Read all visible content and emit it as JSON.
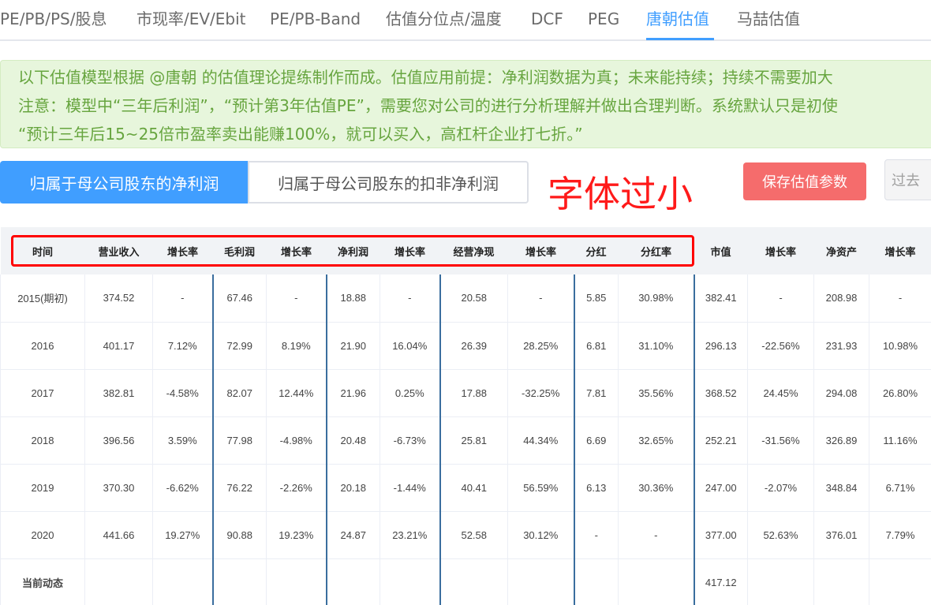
{
  "tabs": [
    {
      "label": "PE/PB/PS/股息",
      "active": false
    },
    {
      "label": "市现率/EV/Ebit",
      "active": false
    },
    {
      "label": "PE/PB-Band",
      "active": false
    },
    {
      "label": "估值分位点/温度",
      "active": false
    },
    {
      "label": "DCF",
      "active": false
    },
    {
      "label": "PEG",
      "active": false
    },
    {
      "label": "唐朝估值",
      "active": true
    },
    {
      "label": "马喆估值",
      "active": false
    }
  ],
  "notice": {
    "line1": "以下估值模型根据 @唐朝 的估值理论提练制作而成。估值应用前提：净利润数据为真；未来能持续；持续不需要加大",
    "line2": "注意：模型中“三年后利润”，“预计第3年估值PE”，需要您对公司的进行分析理解并做出合理判断。系统默认只是初使",
    "line3": "“预计三年后15~25倍市盈率卖出能赚100%，就可以买入，高杠杆企业打七折。”"
  },
  "switch": {
    "primary_label": "归属于母公司股东的净利润",
    "secondary_label": "归属于母公司股东的扣非净利润"
  },
  "annotation_text": "字体过小",
  "buttons": {
    "save_label": "保存估值参数",
    "past_label": "过去"
  },
  "table": {
    "headers": [
      "时间",
      "营业收入",
      "增长率",
      "毛利润",
      "增长率",
      "净利润",
      "增长率",
      "经营净现",
      "增长率",
      "分红",
      "分红率",
      "市值",
      "增长率",
      "净资产",
      "增长率"
    ],
    "rows": [
      [
        "2015(期初)",
        "374.52",
        "-",
        "67.46",
        "-",
        "18.88",
        "-",
        "20.58",
        "-",
        "5.85",
        "30.98%",
        "382.41",
        "-",
        "208.98",
        "-"
      ],
      [
        "2016",
        "401.17",
        "7.12%",
        "72.99",
        "8.19%",
        "21.90",
        "16.04%",
        "26.39",
        "28.25%",
        "6.81",
        "31.10%",
        "296.13",
        "-22.56%",
        "231.93",
        "10.98%"
      ],
      [
        "2017",
        "382.81",
        "-4.58%",
        "82.07",
        "12.44%",
        "21.96",
        "0.25%",
        "17.88",
        "-32.25%",
        "7.81",
        "35.56%",
        "368.52",
        "24.45%",
        "294.08",
        "26.80%"
      ],
      [
        "2018",
        "396.56",
        "3.59%",
        "77.98",
        "-4.98%",
        "20.48",
        "-6.73%",
        "25.81",
        "44.34%",
        "6.69",
        "32.65%",
        "252.21",
        "-31.56%",
        "326.89",
        "11.16%"
      ],
      [
        "2019",
        "370.30",
        "-6.62%",
        "76.22",
        "-2.26%",
        "20.18",
        "-1.44%",
        "40.41",
        "56.59%",
        "6.13",
        "30.36%",
        "247.00",
        "-2.07%",
        "348.84",
        "6.71%"
      ],
      [
        "2020",
        "441.66",
        "19.27%",
        "90.88",
        "19.23%",
        "24.87",
        "23.21%",
        "52.58",
        "30.12%",
        "-",
        "-",
        "377.00",
        "52.63%",
        "376.01",
        "7.79%"
      ],
      [
        "当前动态",
        "",
        "",
        "",
        "",
        "",
        "",
        "",
        "",
        "",
        "",
        "417.12",
        "",
        "",
        ""
      ]
    ]
  },
  "colors": {
    "accent": "#409eff",
    "danger": "#f56c6c",
    "notice_text": "#67a53f",
    "notice_bg": "#e7f6dc",
    "annotation": "#ff0000"
  }
}
